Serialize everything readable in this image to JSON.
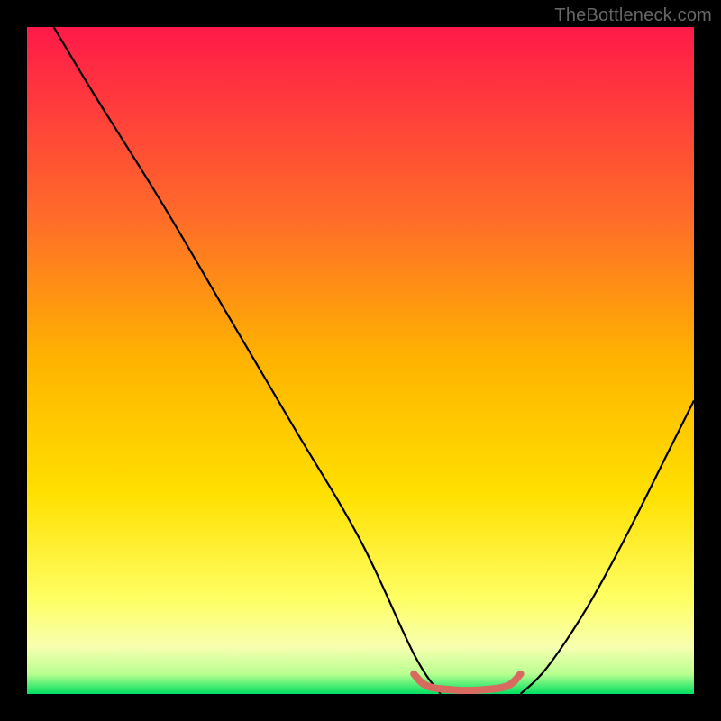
{
  "watermark": "TheBottleneck.com",
  "chart_data": {
    "type": "line",
    "title": "",
    "xlabel": "",
    "ylabel": "",
    "xlim": [
      0,
      100
    ],
    "ylim": [
      0,
      100
    ],
    "grid": false,
    "legend": false,
    "gradient_colors": {
      "top": "#ff1a49",
      "upper_mid": "#ffb400",
      "mid": "#ffe000",
      "lower_mid": "#ffff66",
      "lower": "#f7ffb0",
      "bottom": "#00e060"
    },
    "series": [
      {
        "name": "bottleneck-curve-left",
        "stroke": "#000000",
        "x": [
          4,
          10,
          20,
          30,
          40,
          50,
          58,
          62
        ],
        "y": [
          100,
          90,
          74,
          57,
          40,
          23,
          6,
          0
        ]
      },
      {
        "name": "bottleneck-curve-right",
        "stroke": "#000000",
        "x": [
          74,
          78,
          84,
          90,
          96,
          100
        ],
        "y": [
          0,
          4,
          13,
          24,
          36,
          44
        ]
      },
      {
        "name": "bottleneck-flat-bottom",
        "stroke": "#d86a5f",
        "x": [
          58,
          60,
          64,
          68,
          72,
          74
        ],
        "y": [
          3,
          1.2,
          0.6,
          0.6,
          1.2,
          3
        ]
      }
    ]
  }
}
